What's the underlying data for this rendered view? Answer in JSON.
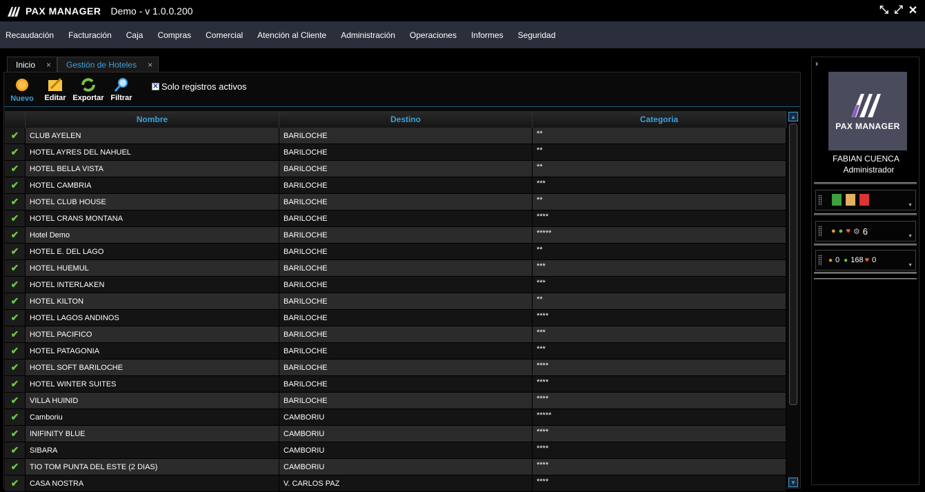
{
  "app": {
    "logo_text": "PAX MANAGER",
    "version": "Demo - v 1.0.0.200"
  },
  "menu": [
    "Recaudación",
    "Facturación",
    "Caja",
    "Compras",
    "Comercial",
    "Atención al Cliente",
    "Administración",
    "Operaciones",
    "Informes",
    "Seguridad"
  ],
  "tabs": [
    {
      "label": "Inicio",
      "close": "×"
    },
    {
      "label": "Gestión de Hoteles",
      "close": "×"
    }
  ],
  "toolbar": {
    "nuevo": "Nuevo",
    "editar": "Editar",
    "exportar": "Exportar",
    "filtrar": "Filtrar",
    "active_only_label": "Solo registros activos",
    "active_only_checked": true
  },
  "grid": {
    "headers": {
      "nombre": "Nombre",
      "destino": "Destino",
      "categoria": "Categoria"
    },
    "rows": [
      {
        "nombre": "CLUB AYELEN",
        "destino": "BARILOCHE",
        "categoria": "**"
      },
      {
        "nombre": "HOTEL AYRES DEL NAHUEL",
        "destino": "BARILOCHE",
        "categoria": "**"
      },
      {
        "nombre": "HOTEL BELLA VISTA",
        "destino": "BARILOCHE",
        "categoria": "**"
      },
      {
        "nombre": "HOTEL CAMBRIA",
        "destino": "BARILOCHE",
        "categoria": "***"
      },
      {
        "nombre": "HOTEL CLUB HOUSE",
        "destino": "BARILOCHE",
        "categoria": "**"
      },
      {
        "nombre": "HOTEL CRANS MONTANA",
        "destino": "BARILOCHE",
        "categoria": "****"
      },
      {
        "nombre": "Hotel Demo",
        "destino": "BARILOCHE",
        "categoria": "*****"
      },
      {
        "nombre": "HOTEL E. DEL LAGO",
        "destino": "BARILOCHE",
        "categoria": "**"
      },
      {
        "nombre": "HOTEL HUEMUL",
        "destino": "BARILOCHE",
        "categoria": "***"
      },
      {
        "nombre": "HOTEL INTERLAKEN",
        "destino": "BARILOCHE",
        "categoria": "***"
      },
      {
        "nombre": "HOTEL KILTON",
        "destino": "BARILOCHE",
        "categoria": "**"
      },
      {
        "nombre": "HOTEL LAGOS ANDINOS",
        "destino": "BARILOCHE",
        "categoria": "****"
      },
      {
        "nombre": "HOTEL PACIFICO",
        "destino": "BARILOCHE",
        "categoria": "***"
      },
      {
        "nombre": "HOTEL PATAGONIA",
        "destino": "BARILOCHE",
        "categoria": "***"
      },
      {
        "nombre": "HOTEL SOFT BARILOCHE",
        "destino": "BARILOCHE",
        "categoria": "****"
      },
      {
        "nombre": "HOTEL WINTER SUITES",
        "destino": "BARILOCHE",
        "categoria": "****"
      },
      {
        "nombre": "VILLA HUINID",
        "destino": "BARILOCHE",
        "categoria": "****"
      },
      {
        "nombre": "Camboriu",
        "destino": "CAMBORIU",
        "categoria": "*****"
      },
      {
        "nombre": "INIFINITY BLUE",
        "destino": "CAMBORIU",
        "categoria": "****"
      },
      {
        "nombre": "SIBARA",
        "destino": "CAMBORIU",
        "categoria": "****"
      },
      {
        "nombre": "TIO TOM PUNTA DEL ESTE (2 DIAS)",
        "destino": "CAMBORIU",
        "categoria": "****"
      },
      {
        "nombre": "CASA NOSTRA",
        "destino": "V. CARLOS PAZ",
        "categoria": "****"
      }
    ]
  },
  "sidebar": {
    "logo_text": "PAX MANAGER",
    "user_name": "FABIAN CUENCA",
    "user_role": "Administrador",
    "widget2_count": "6",
    "widget3_counts": [
      "0",
      "168",
      "0"
    ]
  },
  "colors": {
    "accent": "#3fa0d8",
    "menubar": "#2b2e3b",
    "check": "#6cc644"
  }
}
